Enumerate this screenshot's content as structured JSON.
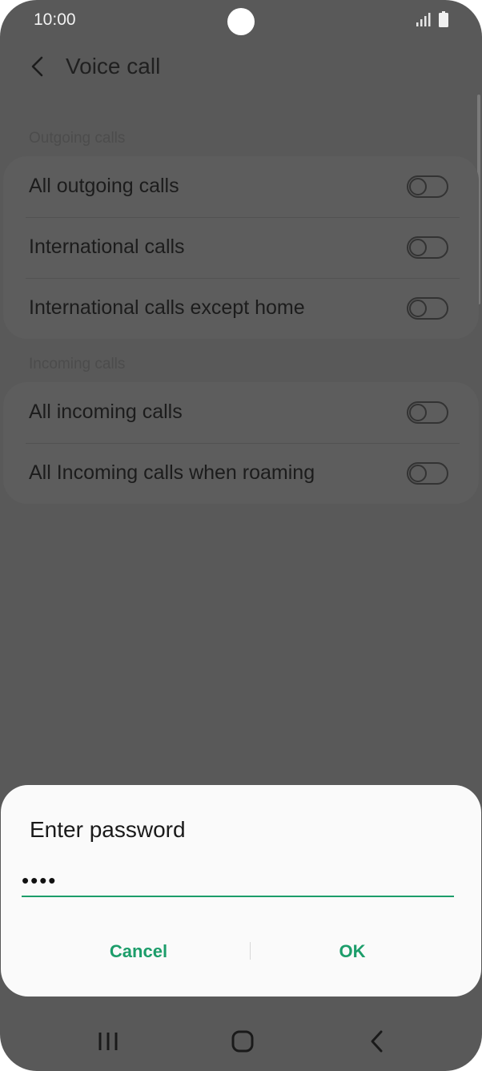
{
  "status_bar": {
    "time": "10:00",
    "signal_icon": "cellular-signal-icon",
    "battery_icon": "battery-icon"
  },
  "header": {
    "title": "Voice call",
    "back_icon": "chevron-left-icon"
  },
  "sections": [
    {
      "label": "Outgoing calls",
      "items": [
        {
          "label": "All outgoing calls",
          "enabled": false
        },
        {
          "label": "International calls",
          "enabled": false
        },
        {
          "label": "International calls except home",
          "enabled": false
        }
      ]
    },
    {
      "label": "Incoming calls",
      "items": [
        {
          "label": "All incoming calls",
          "enabled": false
        },
        {
          "label": "All Incoming calls when roaming",
          "enabled": false
        }
      ]
    }
  ],
  "dialog": {
    "title": "Enter password",
    "password_value": "••••",
    "cancel_label": "Cancel",
    "ok_label": "OK"
  },
  "nav_bar": {
    "recents_icon": "recent-apps-icon",
    "home_icon": "home-icon",
    "back_icon": "back-chevron-icon"
  },
  "colors": {
    "accent": "#1c9d6a",
    "scrim_background": "#595959",
    "dialog_background": "#fafafa"
  }
}
